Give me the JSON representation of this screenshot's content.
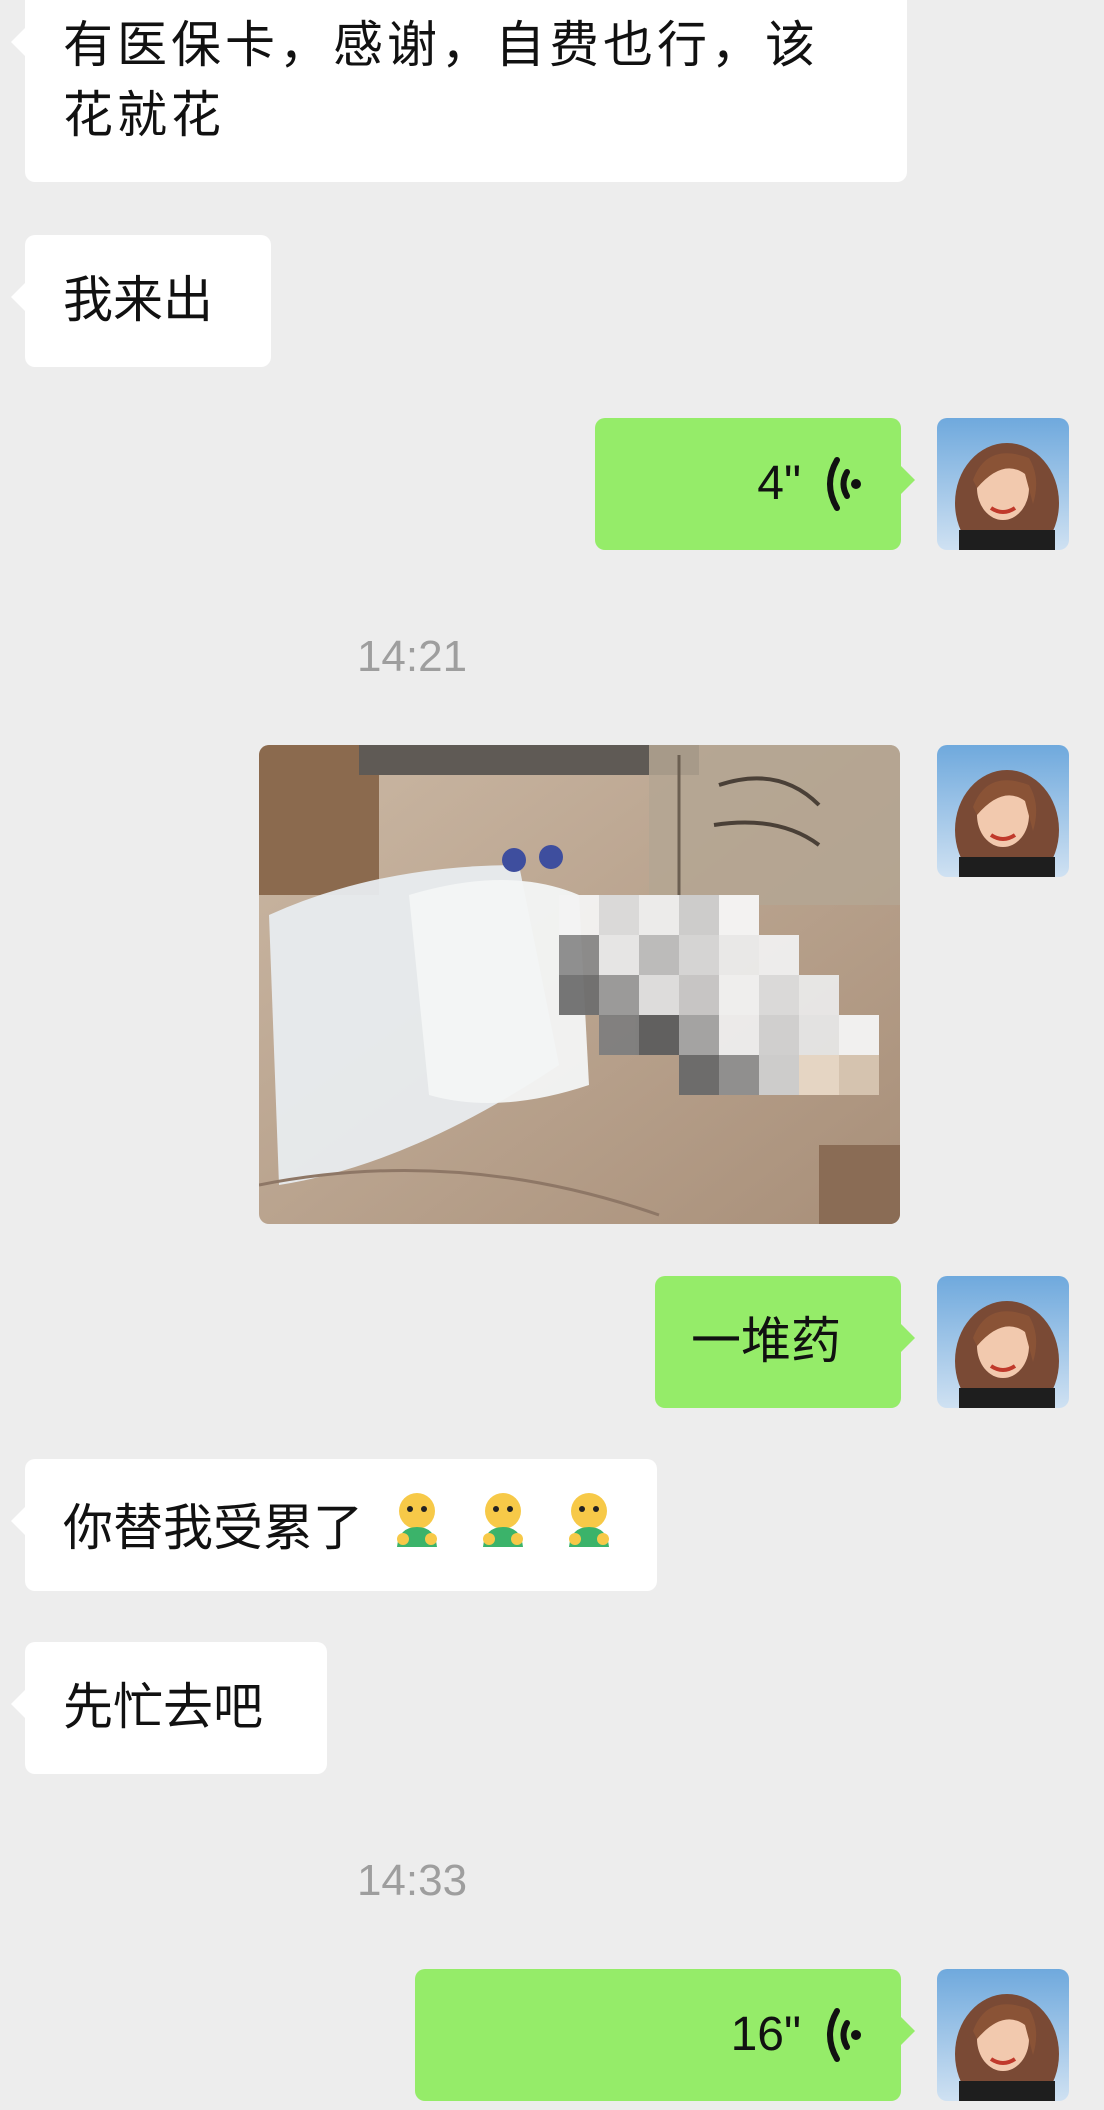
{
  "chat": {
    "messages": [
      {
        "side": "left",
        "type": "text",
        "text": "有医保卡，感谢，自费也行，该花就花"
      },
      {
        "side": "left",
        "type": "text",
        "text": "我来出"
      },
      {
        "side": "right",
        "type": "voice",
        "duration": "4\""
      },
      {
        "type": "timestamp",
        "text": "14:21"
      },
      {
        "side": "right",
        "type": "image",
        "description_icon": "photo-medicine"
      },
      {
        "side": "right",
        "type": "text",
        "text": "一堆药"
      },
      {
        "side": "left",
        "type": "text",
        "text": "你替我受累了",
        "emoji": [
          "bowing-person-emoji",
          "bowing-person-emoji",
          "bowing-person-emoji"
        ]
      },
      {
        "side": "left",
        "type": "text",
        "text": "先忙去吧"
      },
      {
        "type": "timestamp",
        "text": "14:33"
      },
      {
        "side": "right",
        "type": "voice",
        "duration": "16\""
      }
    ]
  },
  "colors": {
    "background": "#ededed",
    "left_bubble": "#ffffff",
    "right_bubble": "#95ec69",
    "timestamp": "#9e9e9e"
  },
  "icons": {
    "voice": "voice-wave-icon",
    "avatar": "user-avatar"
  }
}
